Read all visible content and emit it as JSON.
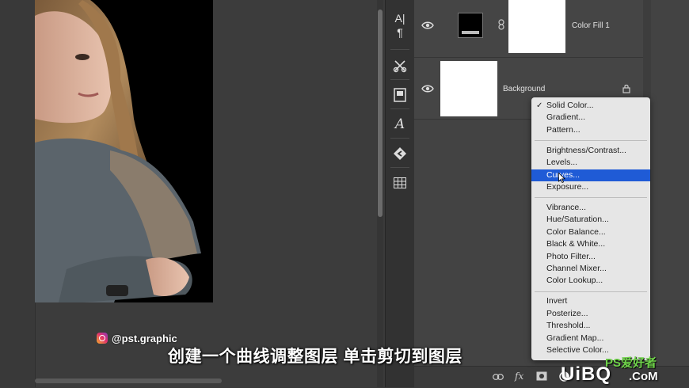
{
  "layers": [
    {
      "name": "Color Fill 1",
      "visible": true,
      "linked": true
    },
    {
      "name": "Background",
      "visible": true,
      "locked": true
    }
  ],
  "tools": [
    "character-paragraph",
    "tools-scissors",
    "properties",
    "glyphs",
    "libraries",
    "grid"
  ],
  "tool_glyphs": {
    "a": "A|",
    "para": "¶",
    "glyph": "A"
  },
  "menu": {
    "checked_index": 0,
    "selected_label": "Curves...",
    "groups": [
      [
        "Solid Color...",
        "Gradient...",
        "Pattern..."
      ],
      [
        "Brightness/Contrast...",
        "Levels...",
        "Curves...",
        "Exposure..."
      ],
      [
        "Vibrance...",
        "Hue/Saturation...",
        "Color Balance...",
        "Black & White...",
        "Photo Filter...",
        "Channel Mixer...",
        "Color Lookup..."
      ],
      [
        "Invert",
        "Posterize...",
        "Threshold...",
        "Gradient Map...",
        "Selective Color..."
      ]
    ]
  },
  "footer": {
    "fx": "fx"
  },
  "overlay": {
    "handle": "@pst.graphic",
    "subtitle": "创建一个曲线调整图层 单击剪切到图层",
    "watermark_a": "UiBQ",
    "watermark_b": ".CoM",
    "watermark_top": "PS爱好者"
  },
  "colors": {
    "accent": "#1f5bd6",
    "menu_bg": "#e6e6e6",
    "panel_bg": "#434343"
  }
}
